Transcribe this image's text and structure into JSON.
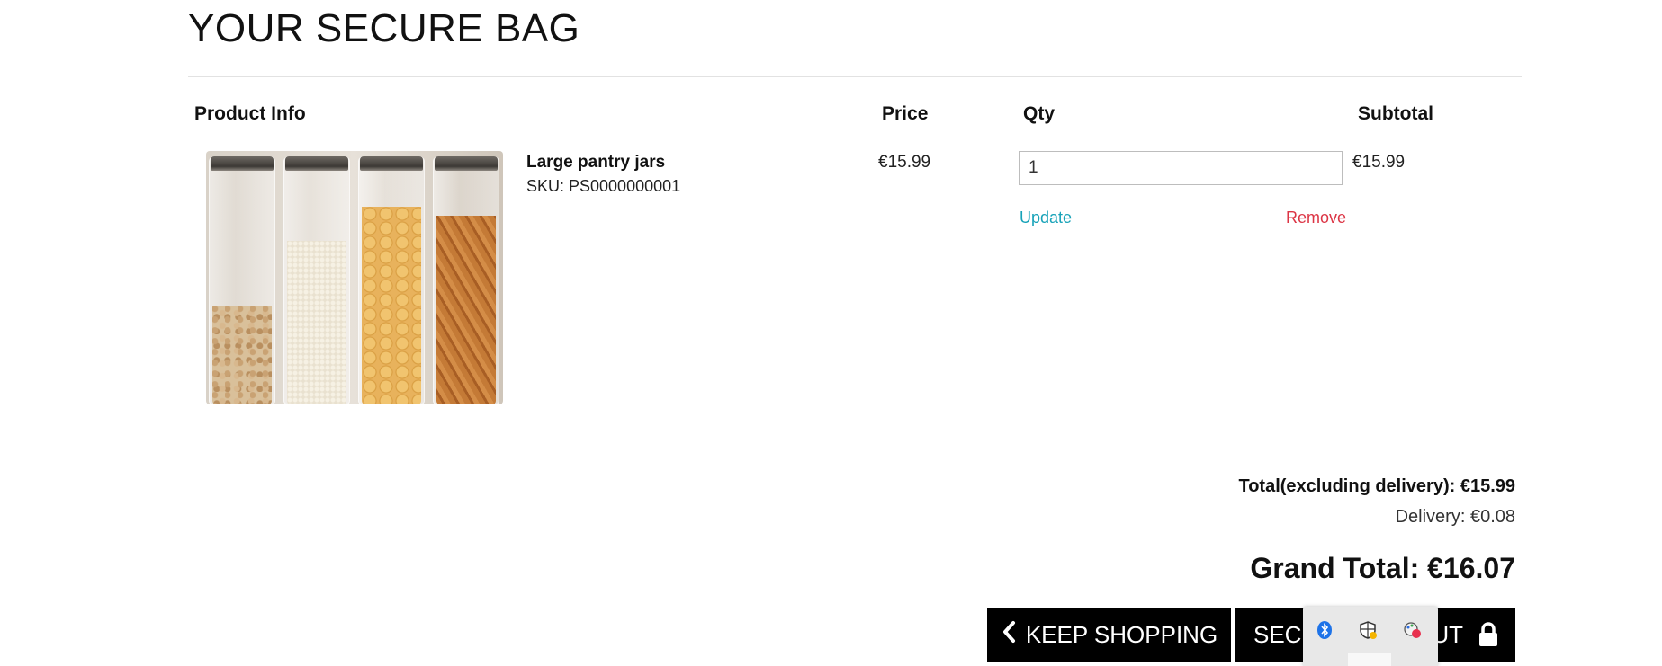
{
  "page": {
    "title": "YOUR SECURE BAG"
  },
  "table": {
    "headers": {
      "product_info": "Product Info",
      "price": "Price",
      "qty": "Qty",
      "subtotal": "Subtotal"
    }
  },
  "item": {
    "name": "Large pantry jars",
    "sku": "SKU: PS0000000001",
    "price": "€15.99",
    "qty": "1",
    "subtotal": "€15.99",
    "update_label": "Update",
    "remove_label": "Remove"
  },
  "summary": {
    "total": "Total(excluding delivery): €15.99",
    "delivery": "Delivery: €0.08",
    "grand_total": "Grand Total: €16.07"
  },
  "actions": {
    "keep_shopping": "KEEP SHOPPING",
    "secure_checkout_visible": "SECU",
    "secure_checkout_tail": "UT"
  },
  "system_tray": {
    "icons": [
      "bluetooth-icon",
      "windows-security-icon",
      "paint-icon"
    ]
  },
  "colors": {
    "update_link": "#17a2b8",
    "remove_link": "#dc3545",
    "button_bg": "#000000"
  }
}
